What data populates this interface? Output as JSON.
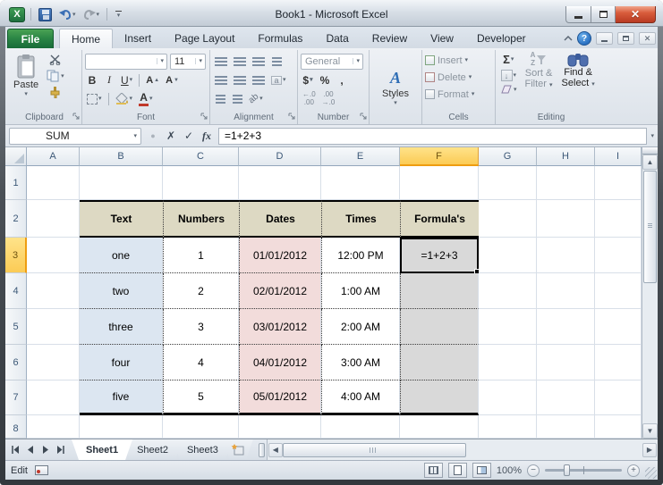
{
  "window": {
    "title": "Book1 - Microsoft Excel"
  },
  "ribbon": {
    "file_tab": "File",
    "tabs": [
      "Home",
      "Insert",
      "Page Layout",
      "Formulas",
      "Data",
      "Review",
      "View",
      "Developer"
    ],
    "active_tab": "Home",
    "clipboard": {
      "label": "Clipboard",
      "paste": "Paste"
    },
    "font": {
      "label": "Font",
      "font_name": "",
      "font_size": "11",
      "bold": "B",
      "italic": "I",
      "underline": "U",
      "letter": "A"
    },
    "alignment": {
      "label": "Alignment",
      "orientation": "ab"
    },
    "number": {
      "label": "Number",
      "format": "General",
      "currency": "$",
      "percent": "%",
      "comma": ",",
      "inc_decimal_top": "←.0",
      "inc_decimal_bot": ".00",
      "dec_decimal_top": ".00",
      "dec_decimal_bot": "→.0"
    },
    "styles": {
      "label": "Styles",
      "icon_letter": "A"
    },
    "cells": {
      "label": "Cells",
      "insert": "Insert",
      "delete": "Delete",
      "format": "Format"
    },
    "editing": {
      "label": "Editing",
      "sum": "Σ",
      "sort_line1": "Sort &",
      "sort_line2": "Filter",
      "find_line1": "Find &",
      "find_line2": "Select",
      "az_top": "A",
      "az_bot": "Z"
    }
  },
  "formula_bar": {
    "name_box": "SUM",
    "fx": "fx",
    "formula": "=1+2+3"
  },
  "sheet": {
    "columns": [
      "A",
      "B",
      "C",
      "D",
      "E",
      "F",
      "G",
      "H",
      "I"
    ],
    "selected_column": "F",
    "rows": [
      "1",
      "2",
      "3",
      "4",
      "5",
      "6",
      "7",
      "8"
    ],
    "selected_row": "3",
    "table": {
      "headers": [
        "Text",
        "Numbers",
        "Dates",
        "Times",
        "Formula's"
      ],
      "rows": [
        [
          "one",
          "1",
          "01/01/2012",
          "12:00 PM",
          "=1+2+3"
        ],
        [
          "two",
          "2",
          "02/01/2012",
          "1:00 AM",
          ""
        ],
        [
          "three",
          "3",
          "03/01/2012",
          "2:00 AM",
          ""
        ],
        [
          "four",
          "4",
          "04/01/2012",
          "3:00 AM",
          ""
        ],
        [
          "five",
          "5",
          "05/01/2012",
          "4:00 AM",
          ""
        ]
      ]
    }
  },
  "sheet_tabs": [
    "Sheet1",
    "Sheet2",
    "Sheet3"
  ],
  "status_bar": {
    "mode": "Edit",
    "zoom": "100%"
  },
  "colors": {
    "file_tab_green": "#2c8746",
    "table_header_fill": "#ddd9c3",
    "text_column_fill": "#dce6f1",
    "dates_column_fill": "#f2dcdb",
    "formula_column_fill": "#d9d9d9",
    "selected_header_fill": "#fbcb55",
    "close_button_red": "#d95d3c"
  }
}
